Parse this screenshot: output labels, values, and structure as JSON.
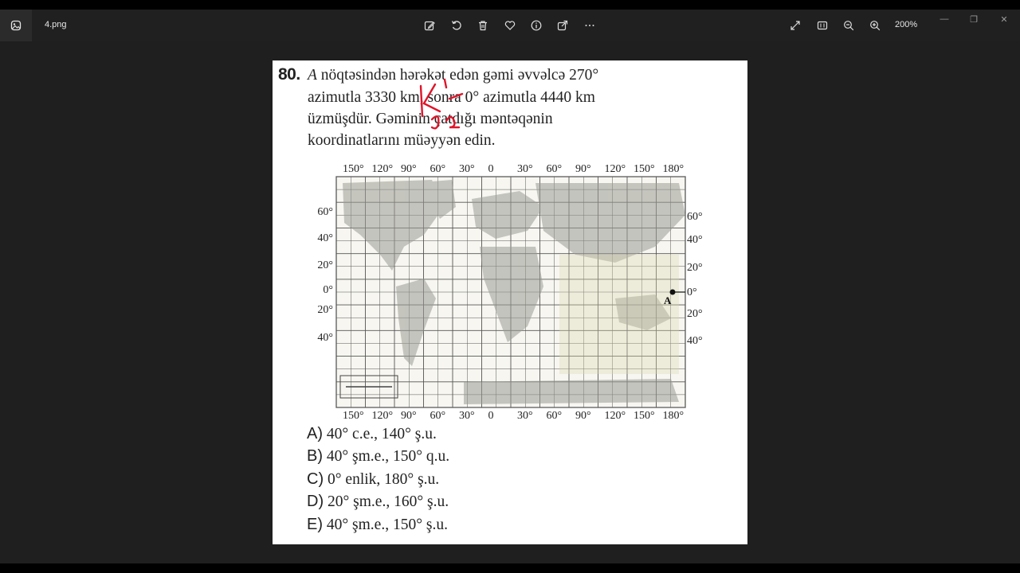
{
  "titlebar": {
    "filename": "4.png",
    "zoom_level": "200%",
    "toolbar_icons": [
      "edit-image-icon",
      "rotate-icon",
      "delete-icon",
      "favorite-icon",
      "info-icon",
      "share-icon",
      "more-icon"
    ],
    "right_icons": [
      "expand-icon",
      "slideshow-icon",
      "zoom-out-icon",
      "zoom-in-icon"
    ],
    "window_buttons": {
      "minimize": "—",
      "maximize": "❐",
      "close": "✕"
    }
  },
  "question": {
    "number": "80.",
    "point_label": "A",
    "line1_rest": " nöqtəsindən hərəkət edən gəmi əvvəlcə 270°",
    "line2": "azimutla 3330 km, sonra 0° azimutla 4440 km",
    "line3": "üzmüşdür. Gəminin çatdığı məntəqənin",
    "line4": "koordinatlarını müəyyən edin."
  },
  "map": {
    "top_longitudes": [
      "150°",
      "120°",
      "90°",
      "60°",
      "30°",
      "0",
      "30°",
      "60°",
      "90°",
      "120°",
      "150°",
      "180°"
    ],
    "bottom_longitudes": [
      "150°",
      "120°",
      "90°",
      "60°",
      "30°",
      "0",
      "30°",
      "60°",
      "90°",
      "120°",
      "150°",
      "180°"
    ],
    "left_latitudes": [
      "60°",
      "40°",
      "20°",
      "0°",
      "20°",
      "40°"
    ],
    "right_latitudes": [
      "60°",
      "40°",
      "20°",
      "0°",
      "20°",
      "40°"
    ],
    "point_label": "A"
  },
  "answers": [
    {
      "letter": "A)",
      "text": "40° c.e., 140° ş.u."
    },
    {
      "letter": "B)",
      "text": "40° şm.e., 150° q.u."
    },
    {
      "letter": "C)",
      "text": "0° enlik, 180° ş.u."
    },
    {
      "letter": "D)",
      "text": "20° şm.e., 160° ş.u."
    },
    {
      "letter": "E)",
      "text": "40° şm.e., 150° ş.u."
    }
  ],
  "annotation_color": "#e0152a"
}
